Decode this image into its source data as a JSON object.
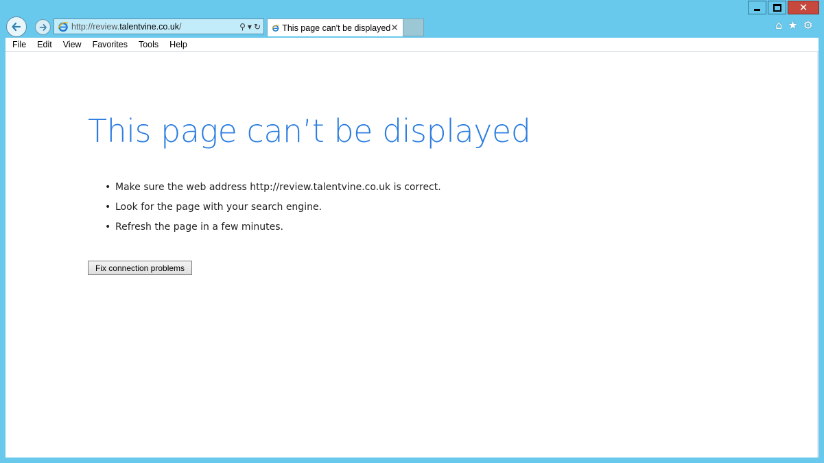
{
  "window": {
    "minimize_glyph": "minimize-icon",
    "maximize_glyph": "maximize-icon",
    "close_glyph": "✕"
  },
  "nav": {
    "back_icon": "←",
    "forward_icon": "→"
  },
  "address_bar": {
    "url_prefix": "http://review.",
    "url_host": "talentvine.co.uk",
    "url_suffix": "/",
    "search_icon": "⚲",
    "dropdown_icon": "▾",
    "refresh_icon": "↻"
  },
  "tab": {
    "title": "This page can't be displayed",
    "close_icon": "✕"
  },
  "toolbar_icons": {
    "home": "⌂",
    "favorites": "★",
    "settings": "⚙"
  },
  "menu": {
    "items": [
      "File",
      "Edit",
      "View",
      "Favorites",
      "Tools",
      "Help"
    ]
  },
  "page": {
    "title": "This page can’t be displayed",
    "tips": [
      "Make sure the web address http://review.talentvine.co.uk is correct.",
      "Look for the page with your search engine.",
      "Refresh the page in a few minutes."
    ],
    "fix_button": "Fix connection problems"
  },
  "colors": {
    "frame": "#68c9ec",
    "title_blue": "#2b7de0",
    "close_red": "#c7493e"
  }
}
